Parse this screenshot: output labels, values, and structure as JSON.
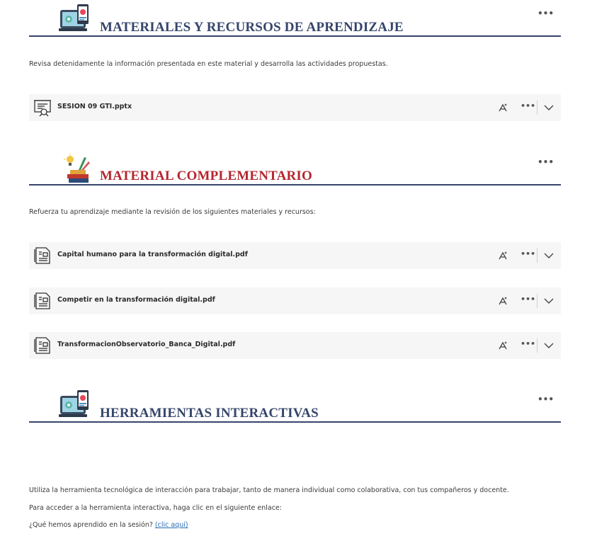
{
  "sections": [
    {
      "title": "MATERIALES Y RECURSOS DE APRENDIZAJE",
      "title_color": "#35456b",
      "icon": "computer-learning-icon",
      "menu_label": "•••",
      "description": "Revisa detenidamente la información presentada en este material y desarrolla las actividades propuestas.",
      "files": [
        {
          "name": "SESION 09 GTI.pptx",
          "icon": "presentation-file-icon"
        }
      ]
    },
    {
      "title": "MATERIAL COMPLEMENTARIO",
      "title_color": "#b5262f",
      "icon": "books-ideas-icon",
      "menu_label": "•••",
      "description": "Refuerza tu aprendizaje mediante la revisión de los siguientes materiales y recursos:",
      "files": [
        {
          "name": "Capital humano para la transformación digital.pdf",
          "icon": "document-file-icon"
        },
        {
          "name": "Competir en la transformación digital.pdf",
          "icon": "document-file-icon"
        },
        {
          "name": "TransformacionObservatorio_Banca_Digital.pdf",
          "icon": "document-file-icon"
        }
      ]
    },
    {
      "title": "HERRAMIENTAS INTERACTIVAS",
      "title_color": "#35456b",
      "icon": "computer-learning-icon",
      "menu_label": "•••",
      "lines": [
        "Utiliza la herramienta tecnológica de interacción para trabajar, tanto de manera individual como colaborativa, con tus compañeros y docente.",
        "Para acceder a la herramienta interactiva, haga clic en el siguiente enlace:"
      ],
      "question_text": "¿Qué hemos aprendido en la sesión? ",
      "link_text": "(clic aquí)"
    }
  ],
  "row_actions": {
    "more_label": "•••"
  },
  "colors": {
    "rule": "#35456b",
    "row_bg": "#f6f6f6",
    "link": "#2a6fb5"
  }
}
